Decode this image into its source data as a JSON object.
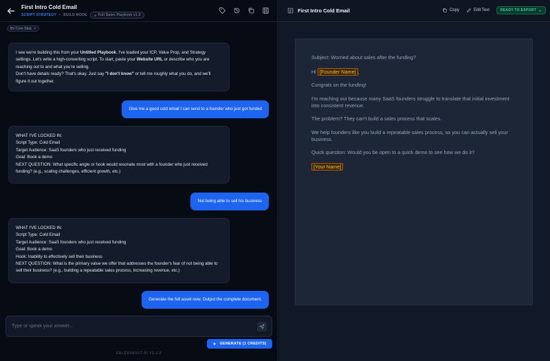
{
  "chat_header": {
    "title": "First Intro Cold Email",
    "strategy": "SCRIPT STRATEGY",
    "separator": "•",
    "mode": "BUILD MODE",
    "playbook": "Full Sales Playbook v1.0"
  },
  "core_chip": {
    "label": "BV Core Stoic",
    "close": "×"
  },
  "messages": {
    "m1": {
      "t1": "I see we're building this from your ",
      "b1": "Untitled Playbook",
      "t2": ". I've loaded your ICP, Value Prop, and Strategy settings. Let's write a high-converting script. To start, paste your ",
      "b2": "Website URL",
      "t3": " or describe who you are reaching out to and what you're selling.",
      "t4": "Don't have details ready? That's okay. Just say ",
      "b3": "\"I don't know\"",
      "t5": " or tell me roughly what you do, and we'll figure it out together."
    },
    "m2": "Give me a good cold email I can send to a founder who just got funded",
    "m3": {
      "heading": "WHAT I'VE LOCKED IN:",
      "l1": "Script Type: Cold Email",
      "l2": "Target Audience: SaaS founders who just received funding",
      "l3": "Goal: Book a demo",
      "l4": "NEXT QUESTION: What specific angle or hook would resonate most with a founder who just received funding? (e.g., scaling challenges, efficient growth, etc.)"
    },
    "m4": "Not being able to sell his business",
    "m5": {
      "heading": "WHAT I'VE LOCKED IN:",
      "l1": "Script Type: Cold Email",
      "l2": "Target Audience: SaaS founders who just received funding",
      "l3": "Goal: Book a demo",
      "l4": "Hook: Inability to effectively sell their business",
      "l5": "NEXT QUESTION: What is the primary value we offer that addresses the founder's fear of not being able to sell their business? (e.g., building a repeatable sales process, increasing revenue, etc.)"
    },
    "m6": "Generate the full asset now. Output the complete document."
  },
  "composer": {
    "placeholder": "Type or speak your answer...",
    "generate_label": "GENERATE (1 CREDITS)"
  },
  "version": "SALESVAULT AI V1.1.0",
  "doc_header": {
    "title": "First Intro Cold Email",
    "copy_label": "Copy",
    "edit_label": "Edit Text",
    "export_label": "READY TO EXPORT"
  },
  "document": {
    "subject": "Subject: Worried about sales after the funding?",
    "hi": "Hi",
    "founder_placeholder": "[Founder Name]",
    "comma": ",",
    "p1": "Congrats on the funding!",
    "p2": "I'm reaching out because many SaaS founders struggle to translate that initial investment into consistent revenue.",
    "p3": "The problem? They can't build a sales process that scales.",
    "p4": "We help founders like you build a repeatable sales process, so you can actually sell your business.",
    "p5": "Quick question: Would you be open to a quick demo to see how we do it?",
    "name_placeholder": "[Your Name]"
  },
  "colors": {
    "accent_blue": "#1d64f0",
    "export_green": "#34d399",
    "placeholder_amber": "#fbbf24"
  },
  "icons": [
    "back-arrow-icon",
    "tag-icon",
    "history-icon",
    "copy-icon",
    "save-icon",
    "document-icon",
    "edit-icon",
    "chevron-down-icon",
    "send-icon",
    "sparkle-icon"
  ]
}
